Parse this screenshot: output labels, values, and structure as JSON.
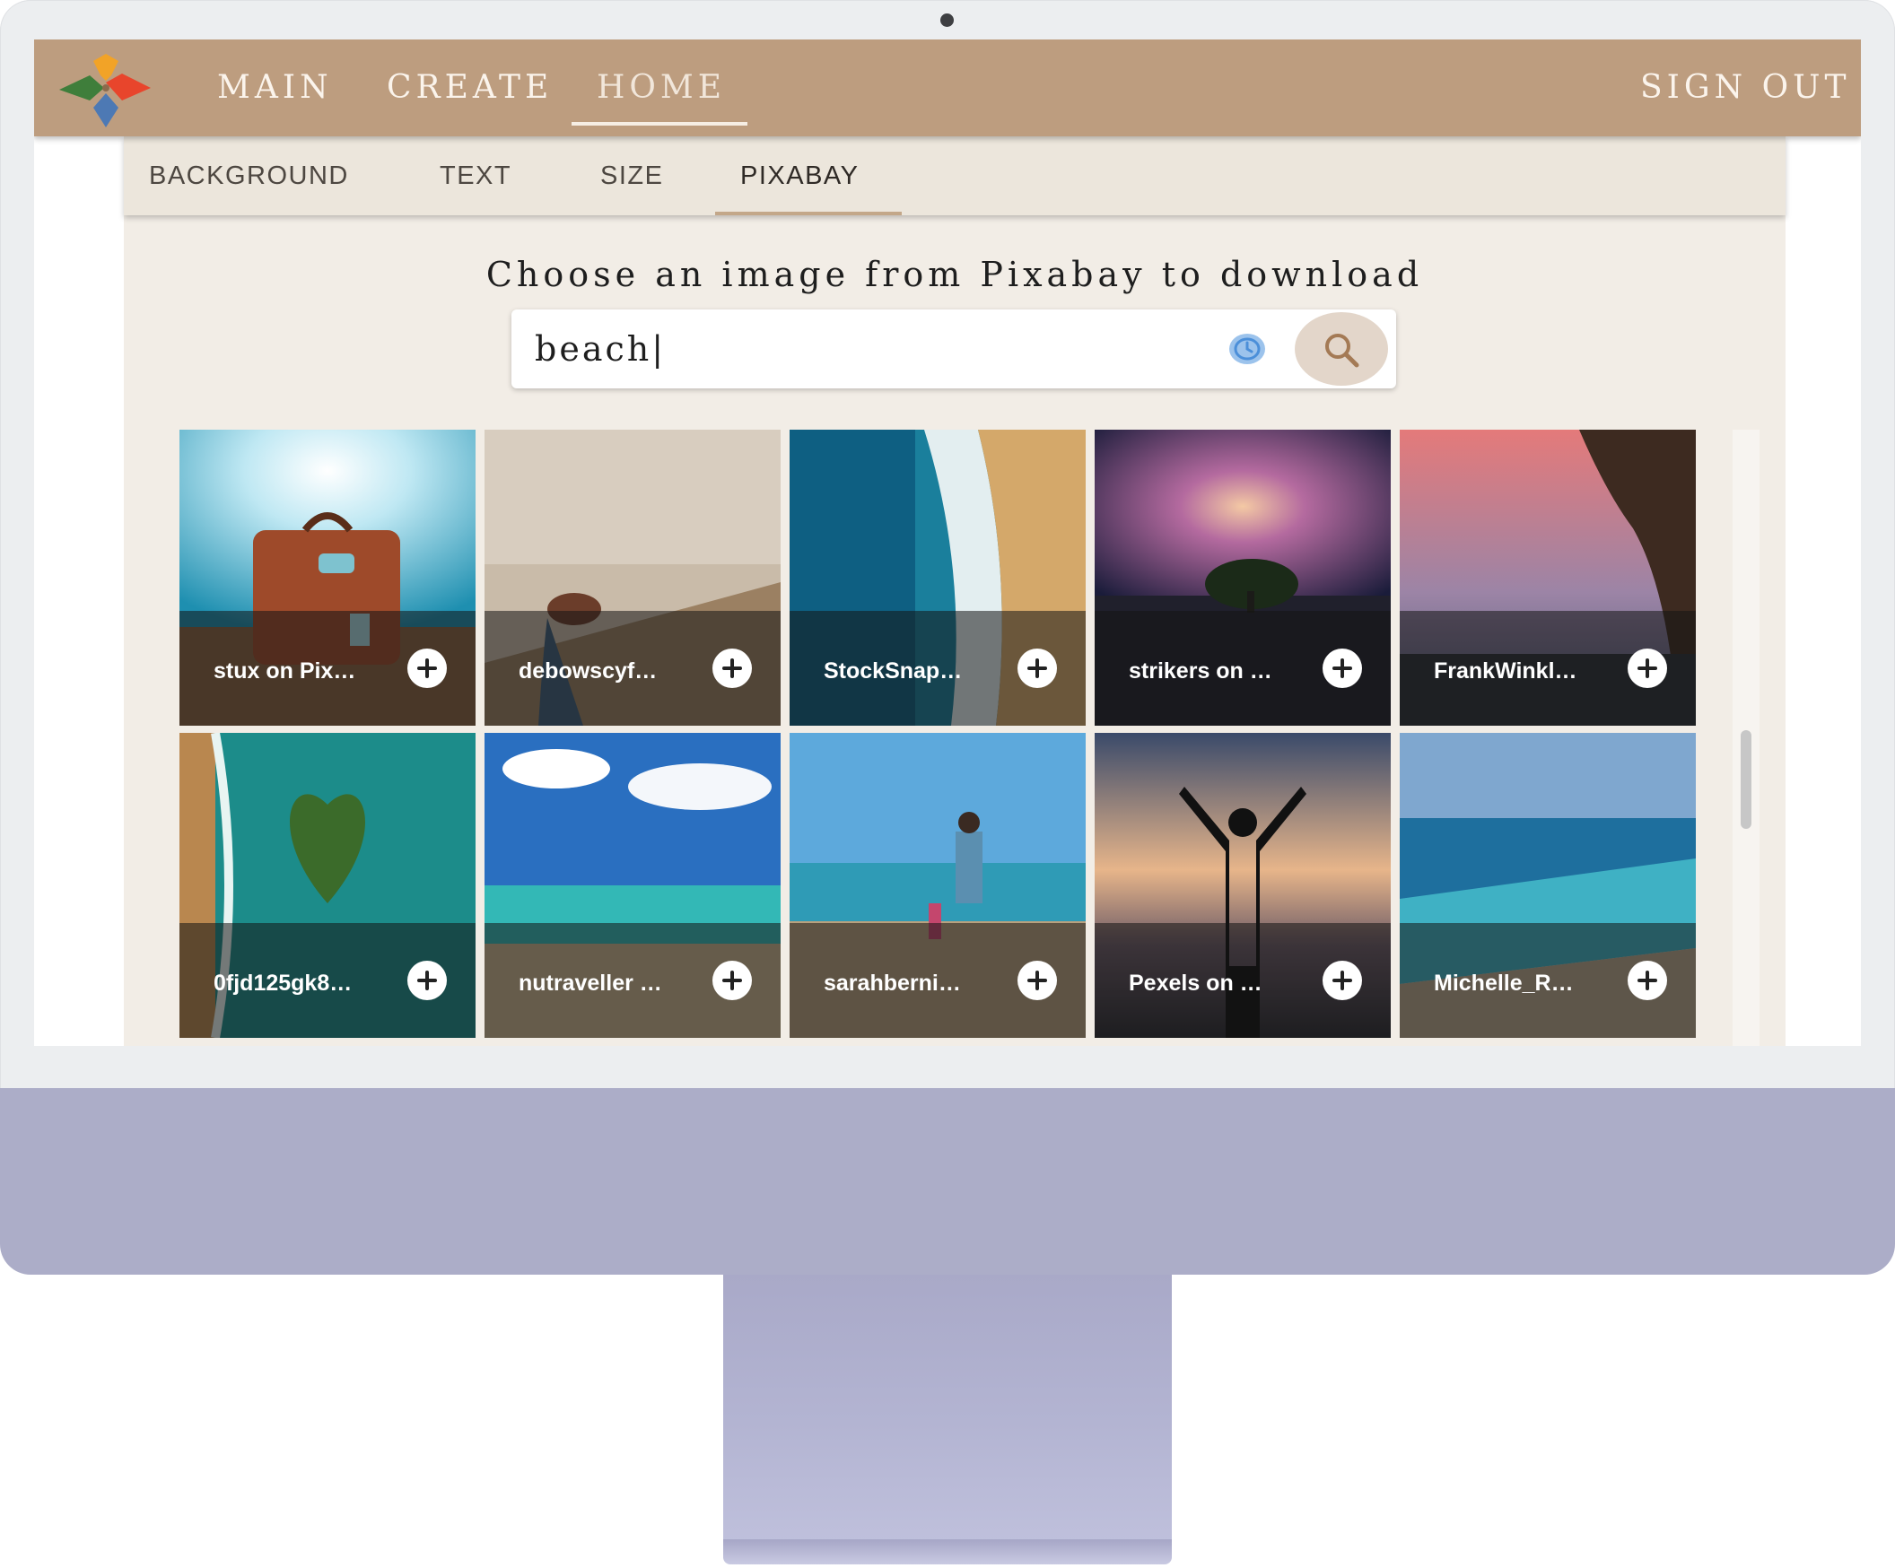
{
  "nav": {
    "main": "MAIN",
    "create": "CREATE",
    "home": "HOME",
    "sign_out": "SIGN OUT"
  },
  "tabs": [
    {
      "label": "BACKGROUND",
      "active": false
    },
    {
      "label": "TEXT",
      "active": false
    },
    {
      "label": "SIZE",
      "active": false
    },
    {
      "label": "PIXABAY",
      "active": true
    }
  ],
  "prompt": "Choose an image from Pixabay to download",
  "search": {
    "value": "beach|",
    "clear_icon": "clear-icon",
    "button_icon": "search-icon"
  },
  "results": [
    {
      "label": "stux on Pix…"
    },
    {
      "label": "debowscyf…"
    },
    {
      "label": "StockSnap…"
    },
    {
      "label": "strikers on …"
    },
    {
      "label": "FrankWinkl…"
    },
    {
      "label": "0fjd125gk8…"
    },
    {
      "label": "nutraveller …"
    },
    {
      "label": "sarahberni…"
    },
    {
      "label": "Pexels on …"
    },
    {
      "label": "Michelle_R…"
    }
  ],
  "colors": {
    "nav_bar": "#bd9d7f",
    "panel_bg": "#f2ede6",
    "tab_bar": "#ece6dc",
    "search_button": "#e3d6ca",
    "monitor_chin": "#acadc8"
  }
}
